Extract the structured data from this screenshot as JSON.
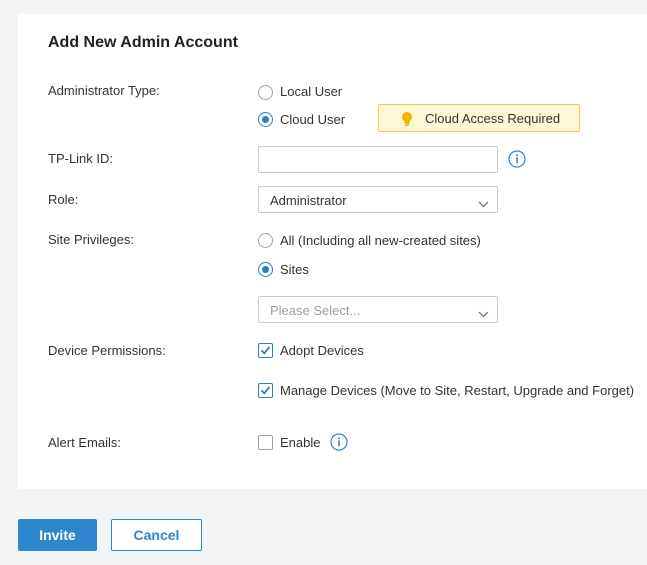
{
  "form": {
    "title": "Add New Admin Account",
    "administrator_type": {
      "label": "Administrator Type:",
      "options": [
        {
          "label": "Local User",
          "checked": false
        },
        {
          "label": "Cloud User",
          "checked": true
        }
      ],
      "badge": "Cloud Access Required"
    },
    "tplink_id": {
      "label": "TP-Link ID:",
      "value": ""
    },
    "role": {
      "label": "Role:",
      "selected": "Administrator"
    },
    "site_privileges": {
      "label": "Site Privileges:",
      "options": [
        {
          "label": "All (Including all new-created sites)",
          "checked": false
        },
        {
          "label": "Sites",
          "checked": true
        }
      ],
      "select_placeholder": "Please Select..."
    },
    "device_permissions": {
      "label": "Device Permissions:",
      "options": [
        {
          "label": "Adopt Devices",
          "checked": true
        },
        {
          "label": "Manage Devices (Move to Site, Restart, Upgrade and Forget)",
          "checked": true
        }
      ]
    },
    "alert_emails": {
      "label": "Alert Emails:",
      "option": {
        "label": "Enable",
        "checked": false
      }
    }
  },
  "actions": {
    "invite_label": "Invite",
    "cancel_label": "Cancel"
  },
  "colors": {
    "accent": "#2e86cf",
    "badge_bg": "#fff8d6",
    "badge_border": "#f2c94c",
    "bulb": "#f5b400"
  },
  "icons": {
    "info": "info-icon",
    "bulb": "lightbulb-icon",
    "chevron": "chevron-down-icon"
  }
}
